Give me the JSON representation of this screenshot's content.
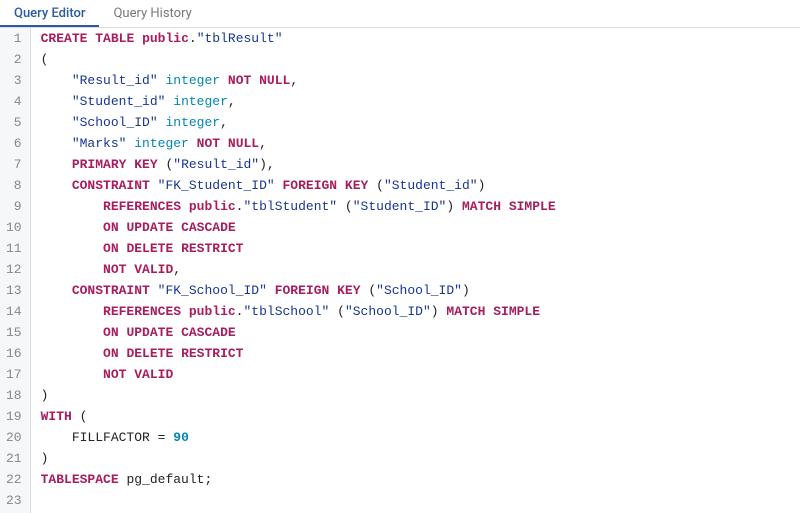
{
  "tabs": {
    "editor": "Query Editor",
    "history": "Query History"
  },
  "code": {
    "lines": [
      [
        [
          "kw",
          "CREATE"
        ],
        [
          "text",
          " "
        ],
        [
          "kw",
          "TABLE"
        ],
        [
          "text",
          " "
        ],
        [
          "kw",
          "public"
        ],
        [
          "text",
          "."
        ],
        [
          "str",
          "\"tblResult\""
        ]
      ],
      [
        [
          "paren",
          "("
        ]
      ],
      [
        [
          "text",
          "    "
        ],
        [
          "str",
          "\"Result_id\""
        ],
        [
          "text",
          " "
        ],
        [
          "type",
          "integer"
        ],
        [
          "text",
          " "
        ],
        [
          "kw",
          "NOT"
        ],
        [
          "text",
          " "
        ],
        [
          "kw",
          "NULL"
        ],
        [
          "text",
          ","
        ]
      ],
      [
        [
          "text",
          "    "
        ],
        [
          "str",
          "\"Student_id\""
        ],
        [
          "text",
          " "
        ],
        [
          "type",
          "integer"
        ],
        [
          "text",
          ","
        ]
      ],
      [
        [
          "text",
          "    "
        ],
        [
          "str",
          "\"School_ID\""
        ],
        [
          "text",
          " "
        ],
        [
          "type",
          "integer"
        ],
        [
          "text",
          ","
        ]
      ],
      [
        [
          "text",
          "    "
        ],
        [
          "str",
          "\"Marks\""
        ],
        [
          "text",
          " "
        ],
        [
          "type",
          "integer"
        ],
        [
          "text",
          " "
        ],
        [
          "kw",
          "NOT"
        ],
        [
          "text",
          " "
        ],
        [
          "kw",
          "NULL"
        ],
        [
          "text",
          ","
        ]
      ],
      [
        [
          "text",
          "    "
        ],
        [
          "kw",
          "PRIMARY"
        ],
        [
          "text",
          " "
        ],
        [
          "kw",
          "KEY"
        ],
        [
          "text",
          " "
        ],
        [
          "paren",
          "("
        ],
        [
          "str",
          "\"Result_id\""
        ],
        [
          "paren",
          ")"
        ],
        [
          "text",
          ","
        ]
      ],
      [
        [
          "text",
          "    "
        ],
        [
          "kw",
          "CONSTRAINT"
        ],
        [
          "text",
          " "
        ],
        [
          "str",
          "\"FK_Student_ID\""
        ],
        [
          "text",
          " "
        ],
        [
          "kw",
          "FOREIGN"
        ],
        [
          "text",
          " "
        ],
        [
          "kw",
          "KEY"
        ],
        [
          "text",
          " "
        ],
        [
          "paren",
          "("
        ],
        [
          "str",
          "\"Student_id\""
        ],
        [
          "paren",
          ")"
        ]
      ],
      [
        [
          "text",
          "        "
        ],
        [
          "kw",
          "REFERENCES"
        ],
        [
          "text",
          " "
        ],
        [
          "kw",
          "public"
        ],
        [
          "text",
          "."
        ],
        [
          "str",
          "\"tblStudent\""
        ],
        [
          "text",
          " "
        ],
        [
          "paren",
          "("
        ],
        [
          "str",
          "\"Student_ID\""
        ],
        [
          "paren",
          ")"
        ],
        [
          "text",
          " "
        ],
        [
          "kw",
          "MATCH"
        ],
        [
          "text",
          " "
        ],
        [
          "kw",
          "SIMPLE"
        ]
      ],
      [
        [
          "text",
          "        "
        ],
        [
          "kw",
          "ON"
        ],
        [
          "text",
          " "
        ],
        [
          "kw",
          "UPDATE"
        ],
        [
          "text",
          " "
        ],
        [
          "kw",
          "CASCADE"
        ]
      ],
      [
        [
          "text",
          "        "
        ],
        [
          "kw",
          "ON"
        ],
        [
          "text",
          " "
        ],
        [
          "kw",
          "DELETE"
        ],
        [
          "text",
          " "
        ],
        [
          "kw",
          "RESTRICT"
        ]
      ],
      [
        [
          "text",
          "        "
        ],
        [
          "kw",
          "NOT"
        ],
        [
          "text",
          " "
        ],
        [
          "kw",
          "VALID"
        ],
        [
          "text",
          ","
        ]
      ],
      [
        [
          "text",
          "    "
        ],
        [
          "kw",
          "CONSTRAINT"
        ],
        [
          "text",
          " "
        ],
        [
          "str",
          "\"FK_School_ID\""
        ],
        [
          "text",
          " "
        ],
        [
          "kw",
          "FOREIGN"
        ],
        [
          "text",
          " "
        ],
        [
          "kw",
          "KEY"
        ],
        [
          "text",
          " "
        ],
        [
          "paren",
          "("
        ],
        [
          "str",
          "\"School_ID\""
        ],
        [
          "paren",
          ")"
        ]
      ],
      [
        [
          "text",
          "        "
        ],
        [
          "kw",
          "REFERENCES"
        ],
        [
          "text",
          " "
        ],
        [
          "kw",
          "public"
        ],
        [
          "text",
          "."
        ],
        [
          "str",
          "\"tblSchool\""
        ],
        [
          "text",
          " "
        ],
        [
          "paren",
          "("
        ],
        [
          "str",
          "\"School_ID\""
        ],
        [
          "paren",
          ")"
        ],
        [
          "text",
          " "
        ],
        [
          "kw",
          "MATCH"
        ],
        [
          "text",
          " "
        ],
        [
          "kw",
          "SIMPLE"
        ]
      ],
      [
        [
          "text",
          "        "
        ],
        [
          "kw",
          "ON"
        ],
        [
          "text",
          " "
        ],
        [
          "kw",
          "UPDATE"
        ],
        [
          "text",
          " "
        ],
        [
          "kw",
          "CASCADE"
        ]
      ],
      [
        [
          "text",
          "        "
        ],
        [
          "kw",
          "ON"
        ],
        [
          "text",
          " "
        ],
        [
          "kw",
          "DELETE"
        ],
        [
          "text",
          " "
        ],
        [
          "kw",
          "RESTRICT"
        ]
      ],
      [
        [
          "text",
          "        "
        ],
        [
          "kw",
          "NOT"
        ],
        [
          "text",
          " "
        ],
        [
          "kw",
          "VALID"
        ]
      ],
      [
        [
          "paren",
          ")"
        ]
      ],
      [
        [
          "kw",
          "WITH"
        ],
        [
          "text",
          " "
        ],
        [
          "paren",
          "("
        ]
      ],
      [
        [
          "text",
          "    "
        ],
        [
          "ident",
          "FILLFACTOR"
        ],
        [
          "text",
          " "
        ],
        [
          "paren",
          "="
        ],
        [
          "text",
          " "
        ],
        [
          "num",
          "90"
        ]
      ],
      [
        [
          "paren",
          ")"
        ]
      ],
      [
        [
          "kw",
          "TABLESPACE"
        ],
        [
          "text",
          " "
        ],
        [
          "ident",
          "pg_default"
        ],
        [
          "semi",
          ";"
        ]
      ],
      [
        [
          "text",
          ""
        ]
      ]
    ]
  }
}
